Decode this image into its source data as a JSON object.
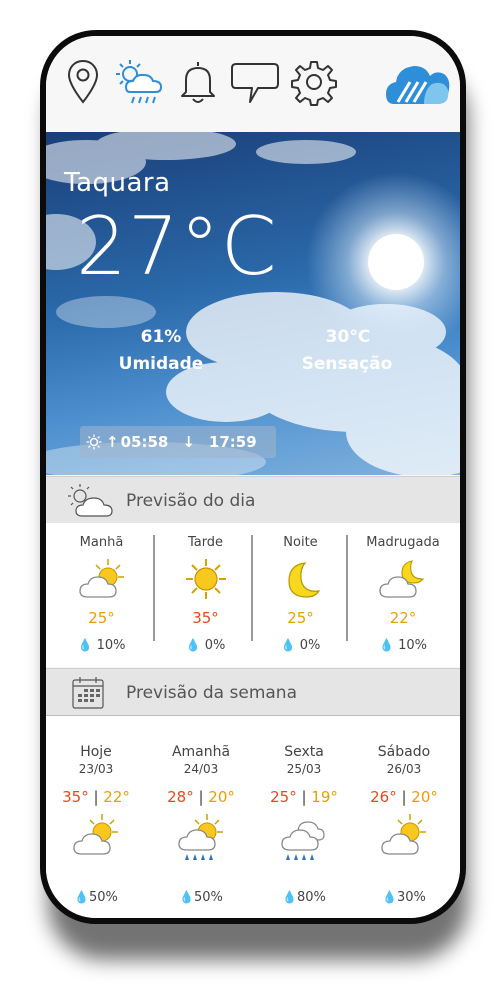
{
  "location": {
    "city": "Taquara",
    "temperature": "27°C",
    "humidity_value": "61%",
    "humidity_label": "Umidade",
    "feels_like_value": "30°C",
    "feels_like_label": "Sensação",
    "sunrise": "05:58",
    "sunset": "17:59"
  },
  "topbar": {
    "icons": [
      "location-pin-icon",
      "weather-icon",
      "bell-icon",
      "chat-icon",
      "gear-icon",
      "app-logo-icon"
    ],
    "accent_color": "#2e8fd8"
  },
  "daily": {
    "title": "Previsão do dia",
    "periods": [
      {
        "label": "Manhã",
        "temp": "25°",
        "precip": "10%",
        "icon": "partly-sunny-icon"
      },
      {
        "label": "Tarde",
        "temp": "35°",
        "precip": "0%",
        "icon": "sun-icon"
      },
      {
        "label": "Noite",
        "temp": "25°",
        "precip": "0%",
        "icon": "moon-icon"
      },
      {
        "label": "Madrugada",
        "temp": "22°",
        "precip": "10%",
        "icon": "moon-cloud-icon"
      }
    ]
  },
  "weekly": {
    "title": "Previsão da semana",
    "days": [
      {
        "day": "Hoje",
        "date": "23/03",
        "high": "35°",
        "low": "22°",
        "precip": "50%",
        "icon": "partly-sunny-icon"
      },
      {
        "day": "Amanhã",
        "date": "24/03",
        "high": "28°",
        "low": "20°",
        "precip": "50%",
        "icon": "sun-rain-icon"
      },
      {
        "day": "Sexta",
        "date": "25/03",
        "high": "25°",
        "low": "19°",
        "precip": "80%",
        "icon": "cloud-rain-icon"
      },
      {
        "day": "Sábado",
        "date": "26/03",
        "high": "26°",
        "low": "20°",
        "precip": "30%",
        "icon": "partly-sunny-icon"
      }
    ]
  },
  "colors": {
    "high_temp": "#e54a1e",
    "low_temp": "#e8a000",
    "drop": "#2e72b8"
  }
}
